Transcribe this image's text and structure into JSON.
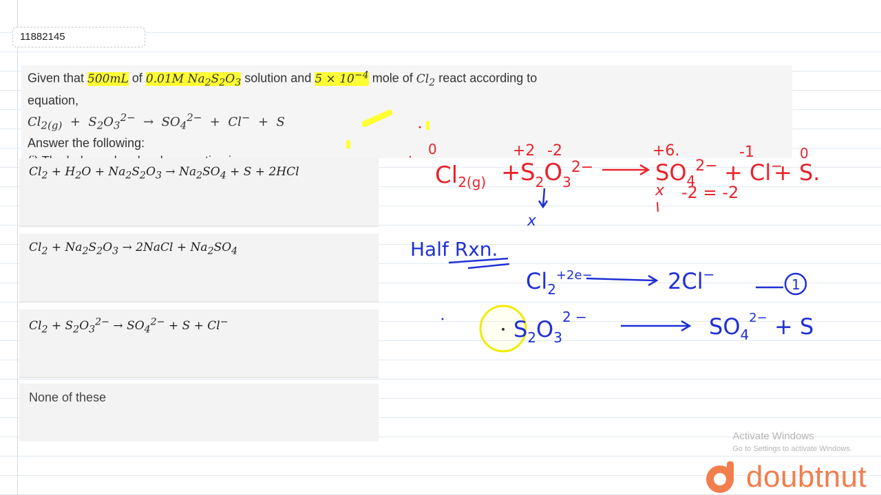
{
  "question_id": "11882145",
  "question": {
    "line1": {
      "p1": "Given that ",
      "vol": "500mL",
      "p2": " of ",
      "conc": "0.01M Na",
      "p3": " solution and ",
      "mol": "5 × 10",
      "mol_exp": "−4",
      "p4": " mole of ",
      "cl2": "Cl",
      "p5": " react according to"
    },
    "line2": "equation,",
    "equation_line": "Cl2(g) + S2O3^2- → SO4^2- + Cl- + S",
    "line4": "Answer the following:",
    "line5": "(i) The balanced molecular equation is:"
  },
  "options": [
    {
      "text": "Cl2 + H2O + Na2S2O3 → Na2SO4 + S + 2HCl"
    },
    {
      "text": "Cl2 + Na2S2O3 → 2NaCl + Na2SO4"
    },
    {
      "text": "Cl2 + S2O3^2- → SO4^2- + S + Cl-"
    },
    {
      "text": "None of these"
    }
  ],
  "handwriting": {
    "red_top_numbers": [
      "0",
      "+2",
      "-2",
      "+6",
      "-1",
      "0"
    ],
    "red_reaction": "Cl2(g) + S2O3^2- → SO4^2- + Cl- + S.",
    "red_x": "x",
    "red_solve": "x - 2 = -2",
    "blue_heading": "Half Rxn.",
    "blue_eq1_left": "Cl2 + 2e-",
    "blue_eq1_right": "2Cl-",
    "blue_eq1_tag": "1",
    "blue_eq2_left": "S2O3^2-",
    "blue_eq2_right": "SO4^2- + S"
  },
  "watermark": {
    "line1": "Activate Windows",
    "line2": "Go to Settings to activate Windows."
  },
  "brand": {
    "name": "doubtnut"
  },
  "colors": {
    "red_ink": "#e8232b",
    "blue_ink": "#1f2fd6",
    "highlight": "#ffff33",
    "brand": "#f27e4d"
  }
}
